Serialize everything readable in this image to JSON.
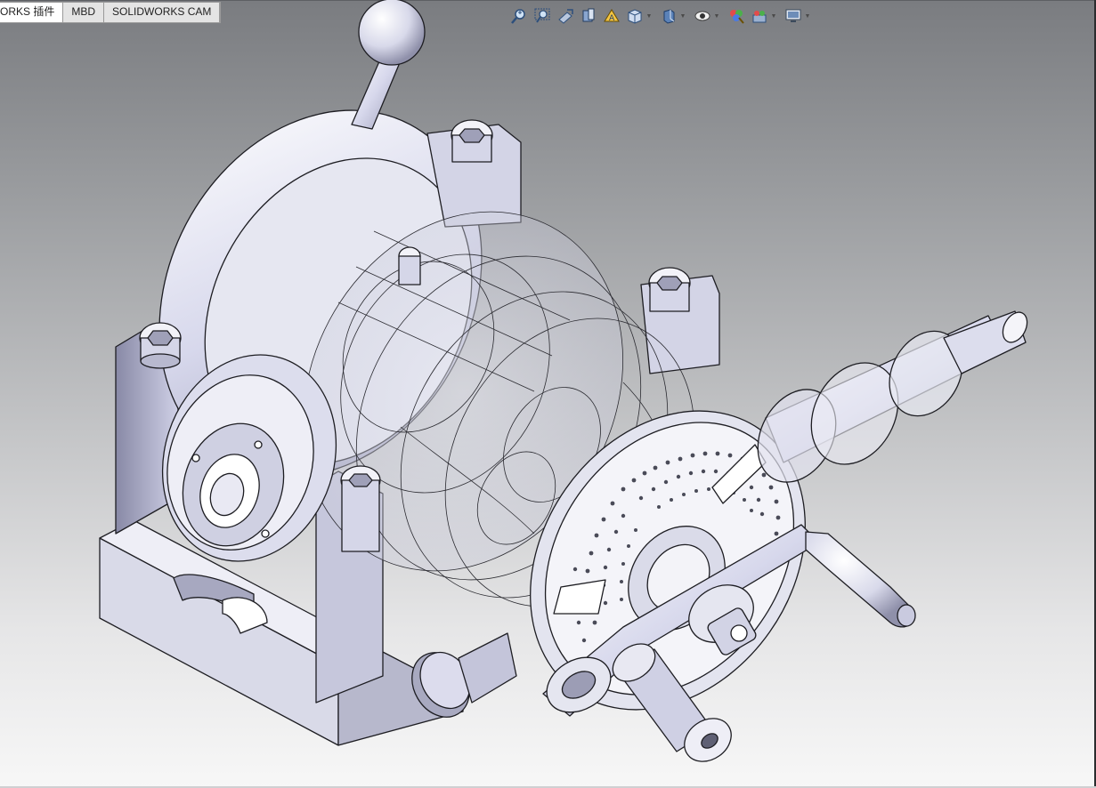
{
  "command_manager": {
    "tabs": [
      {
        "label": "ORKS 插件",
        "active": true
      },
      {
        "label": "MBD",
        "active": false
      },
      {
        "label": "SOLIDWORKS CAM",
        "active": false
      }
    ]
  },
  "heads_up_toolbar": {
    "items": [
      "zoom-to-fit-icon",
      "zoom-to-area-icon",
      "previous-view-icon",
      "section-view-icon",
      "dynamic-annotation-views-icon",
      "view-orientation-icon",
      "display-style-icon",
      "hide-show-items-icon",
      "edit-appearance-icon",
      "apply-scene-icon",
      "view-settings-icon"
    ]
  },
  "viewport": {
    "model": "dividing-head-assembly",
    "background_top": "#7a7c80",
    "background_bottom": "#f7f7f7",
    "accent_part": "#c9cbe6"
  }
}
